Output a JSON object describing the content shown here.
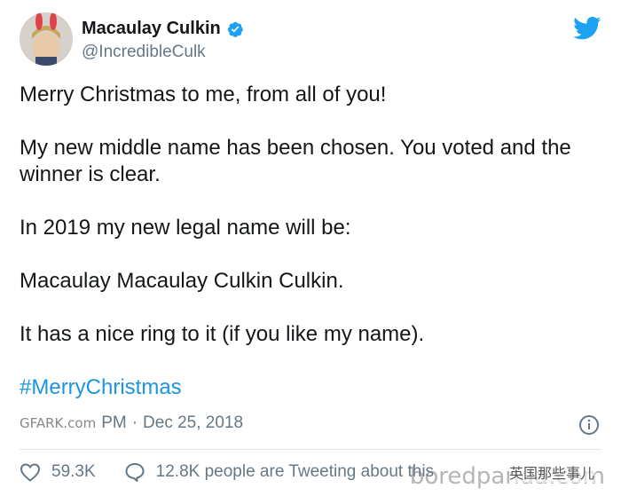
{
  "author": {
    "display_name": "Macaulay Culkin",
    "handle": "@IncredibleCulk"
  },
  "icons": {
    "verified": "verified-badge-icon",
    "twitter": "twitter-bird-icon",
    "info": "info-icon",
    "like": "heart-icon",
    "reply": "speech-bubble-icon"
  },
  "colors": {
    "brand": "#1da1f2",
    "hashtag": "#1b95e0",
    "secondary_text": "#657786"
  },
  "body": {
    "line1": "Merry Christmas to me, from all of you!",
    "line2": "My new middle name has been chosen. You voted and the winner is clear.",
    "line3": "In 2019 my new legal name will be:",
    "line4": "Macaulay Macaulay Culkin Culkin.",
    "line5": "It has a nice ring to it (if you like my name).",
    "hashtag": "#MerryChristmas"
  },
  "meta": {
    "time_fragment": "PM",
    "separator": "·",
    "date": "Dec 25, 2018"
  },
  "actions": {
    "likes": "59.3K",
    "conversation": "12.8K people are Tweeting about this"
  },
  "watermarks": {
    "left": "GFARK.com",
    "right": "boredpanda.com",
    "cn": "英国那些事儿"
  }
}
